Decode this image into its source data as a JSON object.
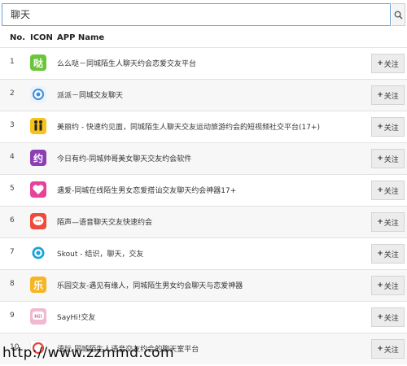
{
  "search": {
    "value": "聊天"
  },
  "table": {
    "headers": {
      "no": "No.",
      "icon": "ICON",
      "app_name": "APP Name"
    },
    "follow_label": "关注",
    "rows": [
      {
        "no": "1",
        "name": "么么哒－同城陌生人聊天约会恋爱交友平台",
        "icon": "mmd-app-icon",
        "color": "#6ac53a"
      },
      {
        "no": "2",
        "name": "派派－同城交友聊天",
        "icon": "paipai-app-icon",
        "color": "#eaf3fb"
      },
      {
        "no": "3",
        "name": "美丽约 - 快速约见面，同城陌生人聊天交友运动旅游约会的短视频社交平台(17+)",
        "icon": "meiliyue-app-icon",
        "color": "#f6c21b"
      },
      {
        "no": "4",
        "name": "今日有约-同城帅哥美女聊天交友约会软件",
        "icon": "jinriyouyue-app-icon",
        "color": "#8c3fb5"
      },
      {
        "no": "5",
        "name": "遇爱-同城在线陌生男女恋爱搭讪交友聊天约会神器17+",
        "icon": "yuai-app-icon",
        "color": "#e8419a"
      },
      {
        "no": "6",
        "name": "陌声—语音聊天交友快速约会",
        "icon": "mosheng-app-icon",
        "color": "#f04b3a"
      },
      {
        "no": "7",
        "name": "Skout - 结识，聊天，交友",
        "icon": "skout-app-icon",
        "color": "#ffffff"
      },
      {
        "no": "8",
        "name": "乐园交友-遇见有缘人，同城陌生男女约会聊天与恋爱神器",
        "icon": "leyuan-app-icon",
        "color": "#f7b521"
      },
      {
        "no": "9",
        "name": "SayHi!交友",
        "icon": "sayhi-app-icon",
        "color": "#f2b8cf"
      },
      {
        "no": "10",
        "name": "语玩-同城陌生人语音交友约会的聊天室平台",
        "icon": "yuwan-app-icon",
        "color": "#ffffff"
      }
    ]
  },
  "watermark": "http://www.zzmmd.com"
}
